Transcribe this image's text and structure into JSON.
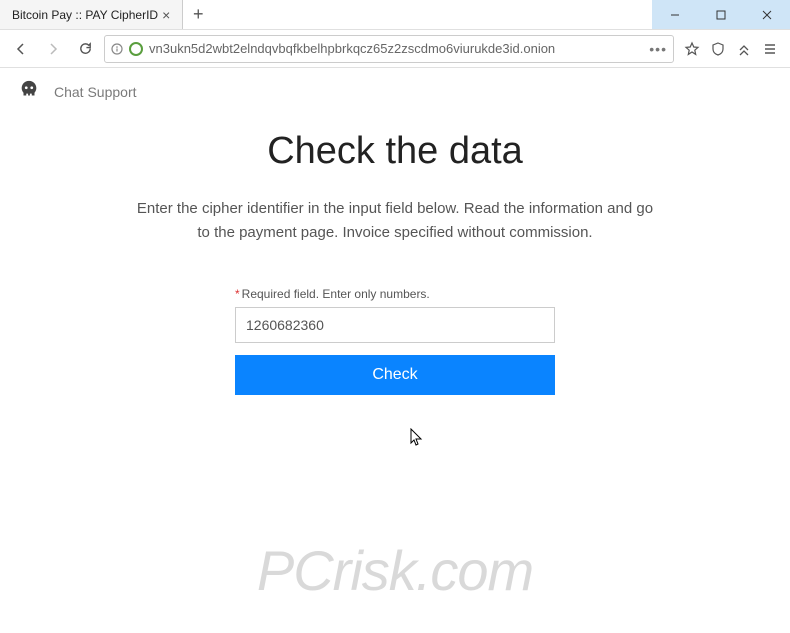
{
  "window": {
    "tab_title": "Bitcoin Pay :: PAY CipherID",
    "url": "vn3ukn5d2wbt2elndqvbqfkbelhpbrkqcz65z2zscdmo6viurukde3id.onion"
  },
  "header": {
    "chat_support": "Chat Support"
  },
  "main": {
    "heading": "Check the data",
    "description": "Enter the cipher identifier in the input field below. Read the information and go to the payment page. Invoice specified without commission.",
    "required_label": "Required field. Enter only numbers.",
    "input_value": "1260682360",
    "check_button": "Check"
  },
  "watermark": "PCrisk.com"
}
